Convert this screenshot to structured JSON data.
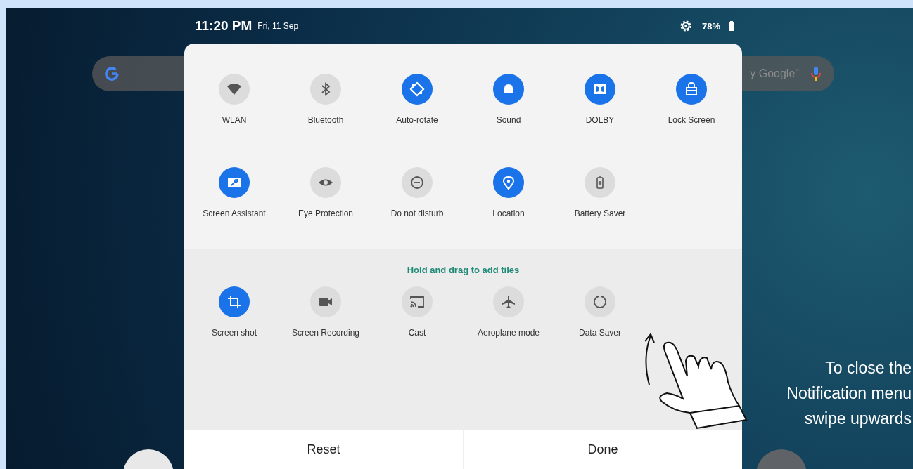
{
  "status_bar": {
    "time": "11:20 PM",
    "date": "Fri, 11 Sep",
    "battery": "78%"
  },
  "search_bar": {
    "placeholder": "y Google\""
  },
  "active_tiles": [
    {
      "label": "WLAN",
      "on": false
    },
    {
      "label": "Bluetooth",
      "on": false
    },
    {
      "label": "Auto-rotate",
      "on": true
    },
    {
      "label": "Sound",
      "on": true
    },
    {
      "label": "DOLBY",
      "on": true
    },
    {
      "label": "Lock Screen",
      "on": true
    },
    {
      "label": "Screen Assistant",
      "on": true
    },
    {
      "label": "Eye Protection",
      "on": false
    },
    {
      "label": "Do not disturb",
      "on": false
    },
    {
      "label": "Location",
      "on": true
    },
    {
      "label": "Battery Saver",
      "on": false
    }
  ],
  "available_section": {
    "title": "Hold and drag to add tiles"
  },
  "available_tiles": [
    {
      "label": "Screen shot",
      "on": true
    },
    {
      "label": "Screen Recording",
      "on": false
    },
    {
      "label": "Cast",
      "on": false
    },
    {
      "label": "Aeroplane mode",
      "on": false
    },
    {
      "label": "Data Saver",
      "on": false
    }
  ],
  "buttons": [
    {
      "label": "Reset"
    },
    {
      "label": "Done"
    }
  ],
  "caption": [
    "To close the",
    "Notification menu",
    "swipe upwards"
  ]
}
